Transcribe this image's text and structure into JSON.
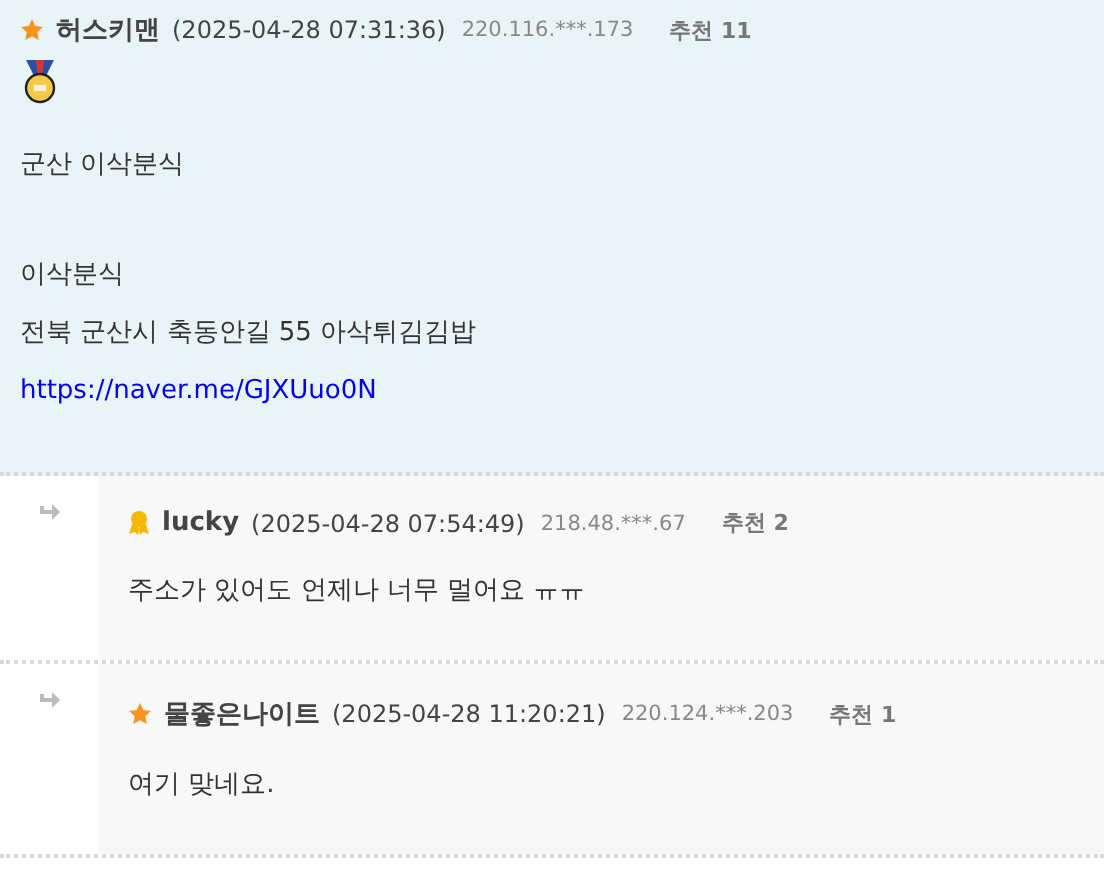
{
  "comments": [
    {
      "reply": false,
      "kind": "star",
      "author": "허스키맨",
      "date": "(2025-04-28 07:31:36)",
      "ip": "220.116.***.173",
      "recommend": "추천 11",
      "medal": true,
      "paragraphs": [
        [
          {
            "text": "군산 이삭분식",
            "kind": "text"
          }
        ],
        [
          {
            "text": "이삭분식",
            "kind": "text"
          },
          {
            "text": "전북 군산시 축동안길 55 아삭튀김김밥",
            "kind": "text"
          },
          {
            "text": "https://naver.me/GJXUuo0N",
            "kind": "link"
          }
        ]
      ]
    },
    {
      "reply": true,
      "kind": "ribbon",
      "author": "lucky",
      "date": "(2025-04-28 07:54:49)",
      "ip": "218.48.***.67",
      "recommend": "추천 2",
      "medal": false,
      "paragraphs": [
        [
          {
            "text": "주소가 있어도 언제나 너무 멀어요 ㅠㅠ",
            "kind": "text"
          }
        ]
      ]
    },
    {
      "reply": true,
      "kind": "star",
      "author": "물좋은나이트",
      "date": "(2025-04-28 11:20:21)",
      "ip": "220.124.***.203",
      "recommend": "추천 1",
      "medal": false,
      "paragraphs": [
        [
          {
            "text": "여기 맞네요.",
            "kind": "text"
          }
        ]
      ]
    }
  ]
}
